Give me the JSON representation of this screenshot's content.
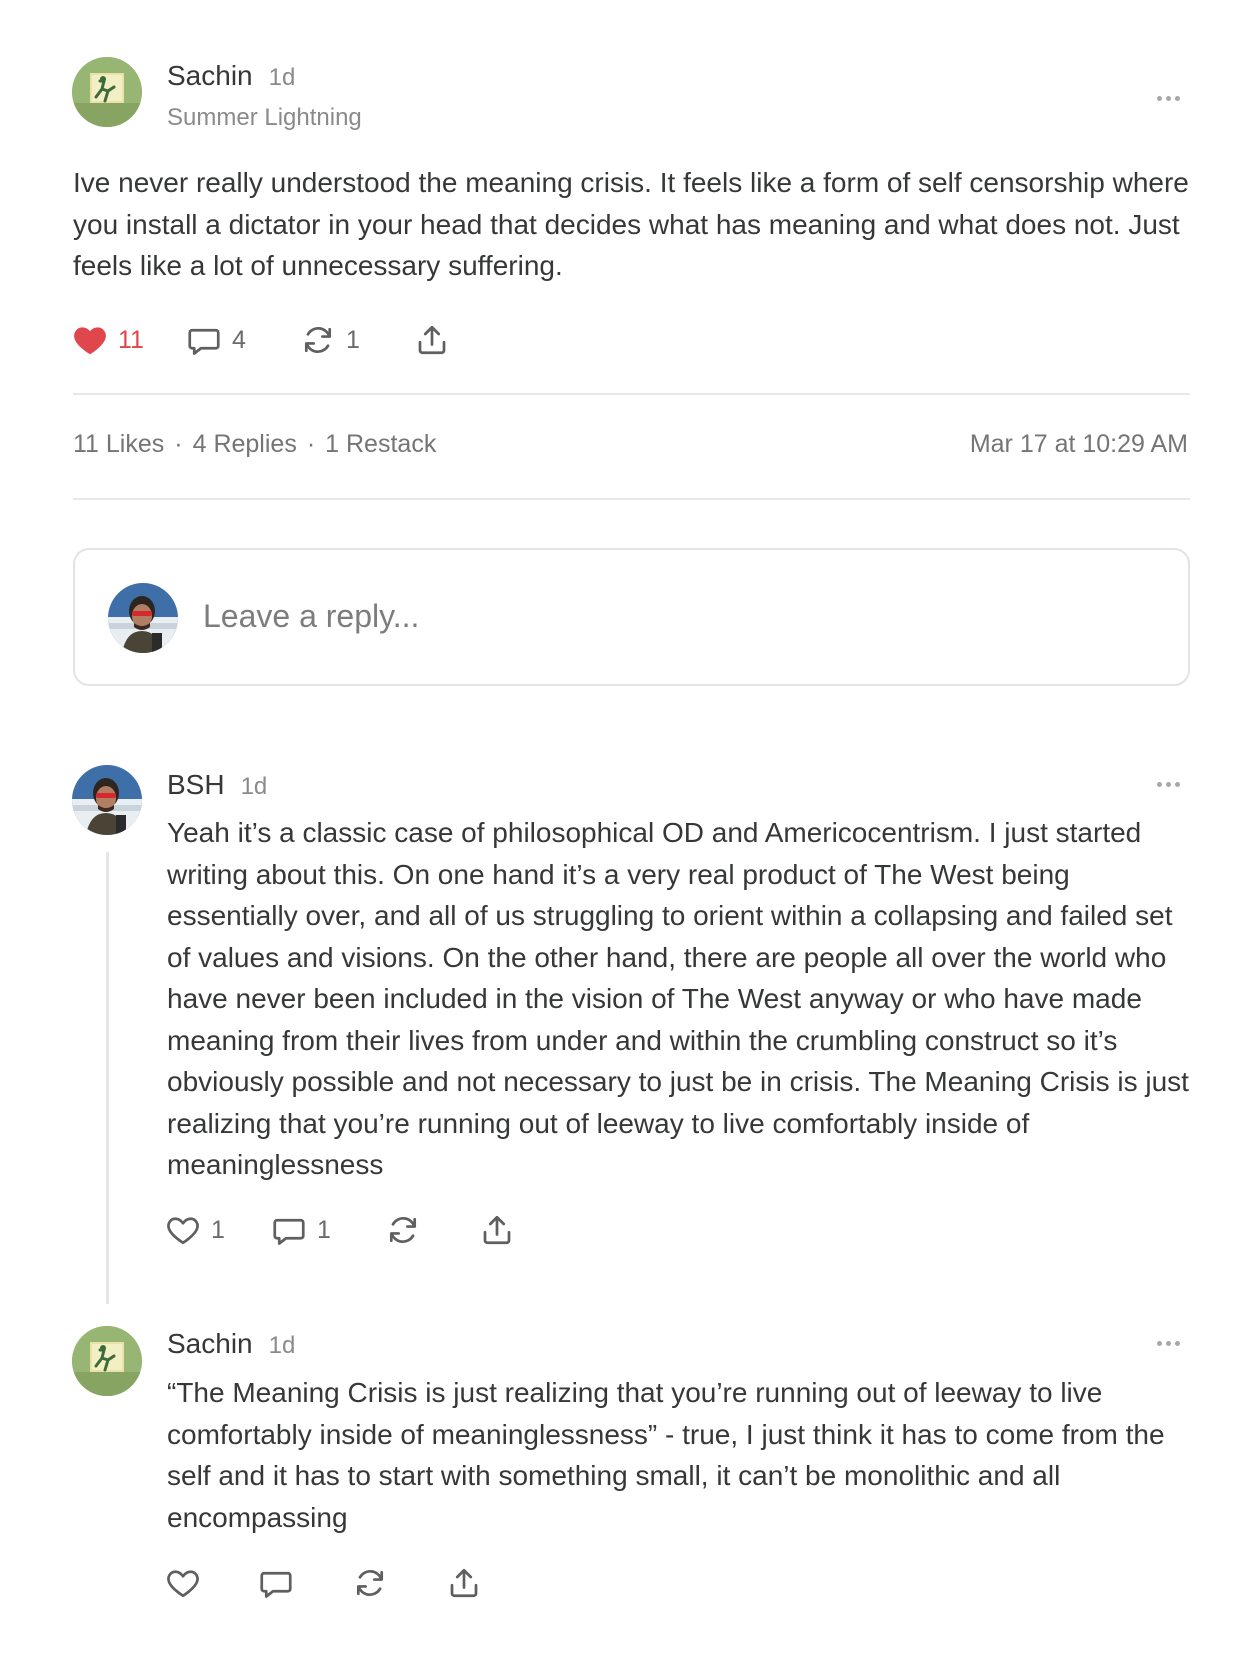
{
  "post": {
    "author": "Sachin",
    "time": "1d",
    "subtitle": "Summer Lightning",
    "text": "Ive never really understood the meaning crisis. It feels like a form of self censorship where you install a dictator in your head that decides what has meaning and what does not. Just feels like a lot of unnecessary suffering.",
    "likes": "11",
    "replies": "4",
    "restacks": "1",
    "liked": true
  },
  "stats": {
    "likes": "11 Likes",
    "replies": "4 Replies",
    "restacks": "1 Restack",
    "separator": "·",
    "timestamp": "Mar 17 at 10:29 AM"
  },
  "reply_box": {
    "placeholder": "Leave a reply..."
  },
  "comments": [
    {
      "author": "BSH",
      "time": "1d",
      "text": "Yeah it’s a classic case of philosophical OD and Americocentrism. I just started writing about this. On one hand it’s a very real product of The West being essentially over, and all of us struggling to orient within a collapsing and failed set of values and visions. On the other hand, there are people all over the world who have never been included in the vision of The West anyway or who have made meaning from their lives from under and within the crumbling construct so it’s obviously possible and not necessary to just be in crisis. The Meaning Crisis is just realizing that you’re running out of leeway to live comfortably inside of meaninglessness",
      "likes": "1",
      "replies": "1"
    },
    {
      "author": "Sachin",
      "time": "1d",
      "text": "“The Meaning Crisis is just realizing that you’re running out of leeway to live comfortably inside of meaninglessness” - true, I just think it has to come from the self and it has to start with something small, it can’t be monolithic and all encompassing"
    }
  ],
  "icons": {
    "like": "heart-icon",
    "comment": "speech-bubble-icon",
    "restack": "restack-arrows-icon",
    "share": "share-upload-icon",
    "more": "more-horizontal-icon"
  },
  "colors": {
    "liked_heart": "#e0474c",
    "text": "#363737",
    "muted": "#8a8a8a",
    "icon": "#6b6b6b"
  }
}
